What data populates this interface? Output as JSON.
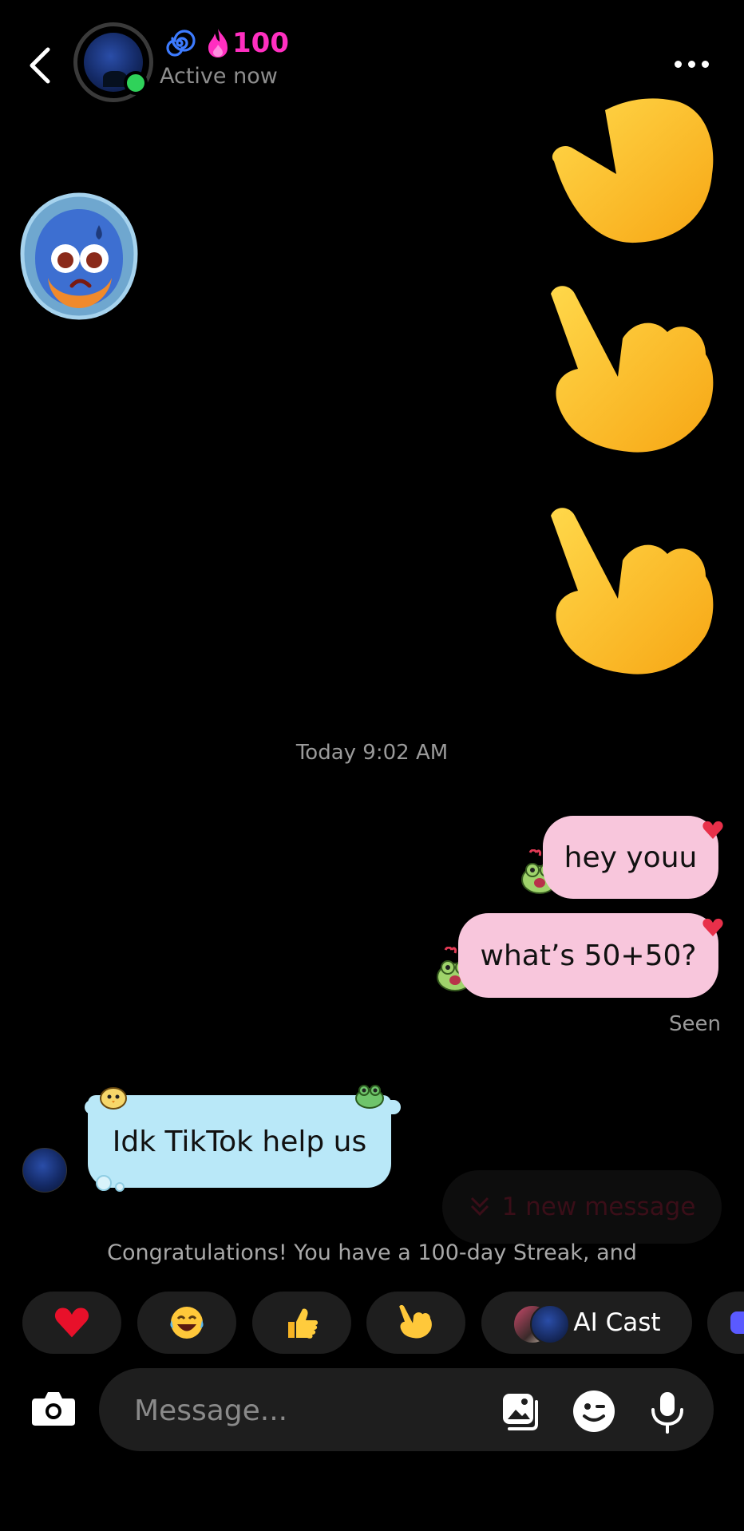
{
  "header": {
    "streak_count": "100",
    "status": "Active now"
  },
  "chat": {
    "timestamp": "Today 9:02 AM",
    "messages": [
      {
        "sender": "me",
        "text": "hey youu"
      },
      {
        "sender": "me",
        "text": "what’s 50+50?"
      },
      {
        "sender": "them",
        "text": "Idk TikTok help us"
      }
    ],
    "seen_label": "Seen",
    "new_message_label": "1 new message",
    "streak_note": "Congratulations! You have a 100-day Streak, and"
  },
  "reactions": {
    "ai_cast_label": "AI Cast"
  },
  "composer": {
    "placeholder": "Message..."
  },
  "colors": {
    "my_bubble": "#f8c6dc",
    "their_bubble": "#b9e8f8",
    "streak_accent": "#ff2fc0",
    "online": "#2fd25a"
  },
  "icons": [
    "back-arrow-icon",
    "spiral-streak-icon",
    "flame-icon",
    "more-dots-icon",
    "pointing-hand-sticker",
    "water-drop-sticker",
    "frog-sticker",
    "heart-icon",
    "camera-icon",
    "photo-icon",
    "emoji-face-icon",
    "microphone-icon"
  ]
}
